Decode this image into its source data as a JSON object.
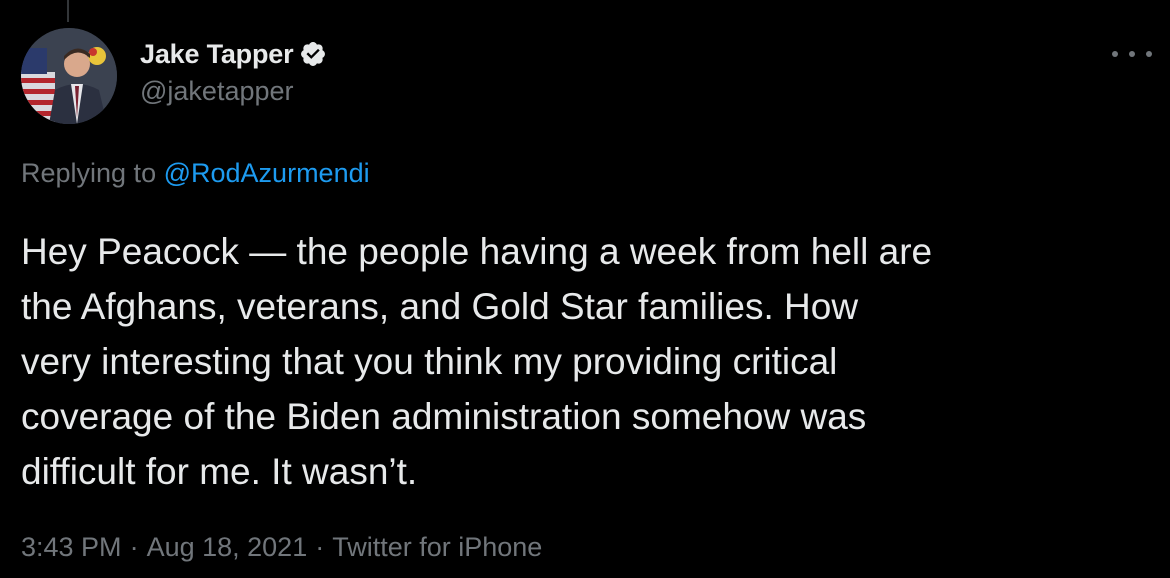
{
  "tweet": {
    "author": {
      "display_name": "Jake Tapper",
      "handle": "@jaketapper",
      "verified": true
    },
    "reply": {
      "prefix": "Replying to",
      "mention": "@RodAzurmendi"
    },
    "text_lines": [
      "Hey Peacock — the people having a week from hell are",
      "the Afghans, veterans, and Gold Star families. How",
      "very interesting that you think my providing critical",
      "coverage of the Biden administration somehow was",
      "difficult for me. It wasn’t."
    ],
    "meta": {
      "time": "3:43 PM",
      "separator": "·",
      "date": "Aug 18, 2021",
      "source": "Twitter for iPhone"
    }
  },
  "icons": {
    "verified": "verified-badge-icon",
    "more": "more-options-icon"
  },
  "colors": {
    "background": "#000000",
    "text_primary": "#e7e9ea",
    "text_secondary": "#71767b",
    "accent": "#1d9bf0"
  }
}
